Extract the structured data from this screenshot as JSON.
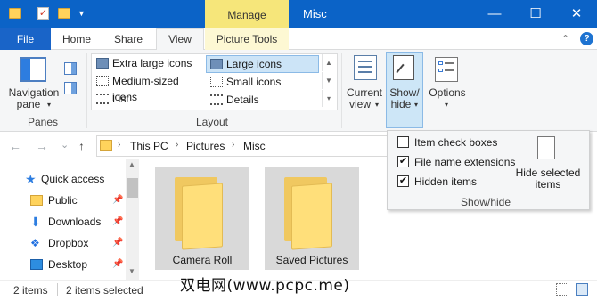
{
  "window": {
    "title": "Misc",
    "context_tab": "Manage",
    "controls": {
      "minimize": "—",
      "maximize": "☐",
      "close": "✕"
    }
  },
  "ribbon_tabs": {
    "file": "File",
    "home": "Home",
    "share": "Share",
    "view": "View",
    "picture_tools": "Picture Tools",
    "collapse": "⌃",
    "help": "?"
  },
  "panes_group": {
    "navigation_pane_line1": "Navigation",
    "navigation_pane_line2": "pane",
    "arrow": "▾",
    "label": "Panes"
  },
  "layout_group": {
    "items": [
      "Extra large icons",
      "Large icons",
      "Medium-sized icons",
      "Small icons",
      "List",
      "Details"
    ],
    "selected": "Large icons",
    "label": "Layout"
  },
  "current_view": {
    "line1": "Current",
    "line2": "view",
    "arrow": "▾"
  },
  "show_hide": {
    "line1": "Show/",
    "line2": "hide",
    "arrow": "▾"
  },
  "options": {
    "label": "Options",
    "arrow": "▾"
  },
  "popup": {
    "item_check_boxes": {
      "label": "Item check boxes",
      "checked": false
    },
    "file_name_extensions": {
      "label": "File name extensions",
      "checked": true
    },
    "hidden_items": {
      "label": "Hidden items",
      "checked": true
    },
    "hide_selected_line1": "Hide selected",
    "hide_selected_line2": "items",
    "group_label": "Show/hide"
  },
  "address": {
    "back": "←",
    "forward": "→",
    "recent": "⌄",
    "up": "↑",
    "crumbs": [
      "This PC",
      "Pictures",
      "Misc"
    ],
    "sep": "›"
  },
  "nav_pane": {
    "quick_access": "Quick access",
    "items": [
      {
        "label": "Public",
        "icon": "folder-icon"
      },
      {
        "label": "Downloads",
        "icon": "download-icon"
      },
      {
        "label": "Dropbox",
        "icon": "dropbox-icon"
      },
      {
        "label": "Desktop",
        "icon": "desktop-icon"
      }
    ],
    "pin": "📌"
  },
  "files": [
    {
      "name": "Camera Roll"
    },
    {
      "name": "Saved Pictures"
    }
  ],
  "status": {
    "count": "2 items",
    "selected": "2 items selected"
  },
  "watermark": "双电网(www.pcpc.me)",
  "colors": {
    "titlebar": "#0b63c7",
    "manage": "#f6e67a",
    "selection": "#cce4f7",
    "folder": "#ffdf7a"
  }
}
